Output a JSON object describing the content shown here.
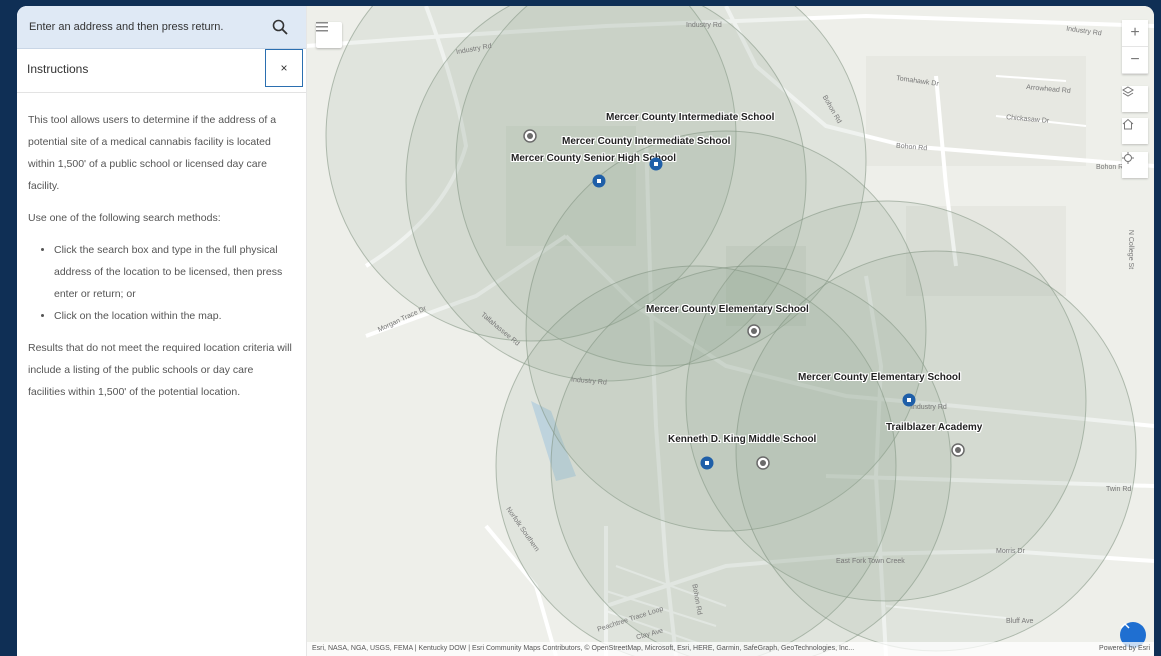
{
  "search": {
    "placeholder": "Enter an address and then press return."
  },
  "instructions": {
    "title": "Instructions",
    "close_label": "×",
    "para1": "This tool allows users to determine if the address of a potential site of a medical cannabis facility is located within 1,500' of a public school or licensed day care facility.",
    "para2": "Use one of the following search methods:",
    "bullets": [
      "Click the search box and type in the full physical address of the location to be licensed, then press enter or return; or",
      "Click on the location within the map."
    ],
    "para3": "Results that do not meet the required location criteria will include a listing of the public schools or day care facilities within 1,500' of the potential location."
  },
  "map": {
    "schools": {
      "s1": "Mercer County Intermediate School",
      "s2": "Mercer County Intermediate School",
      "s3": "Mercer County Senior High School",
      "s4": "Mercer County Elementary School",
      "s5": "Mercer County Elementary School",
      "s6": "Kenneth D. King Middle School",
      "s7": "Trailblazer Academy"
    },
    "roads": {
      "r1": "Industry Rd",
      "r2": "Industry Rd",
      "r3": "Industry Rd",
      "r4": "Tomahawk Dr",
      "r5": "Arrowhead Rd",
      "r6": "Chickasaw Dr",
      "r7": "Bohon Rd",
      "r8": "Bohon Rd",
      "r9": "Bohon Rd",
      "r10": "Morgan Trace Dr",
      "r11": "Tallahassee Rd",
      "r12": "Industry Rd",
      "r13": "Norfolk Southern",
      "r14": "N College St",
      "r15": "Twin Rd",
      "r16": "Morris Dr",
      "r17": "East Fork Town Creek",
      "r18": "Peachtree Trace Loop",
      "r19": "Clay Ave",
      "r20": "Bluff Ave",
      "r21": "Industry Rd",
      "r22": "Bohon Rd"
    },
    "attribution": "Esri, NASA, NGA, USGS, FEMA | Kentucky DOW | Esri Community Maps Contributors, © OpenStreetMap, Microsoft, Esri, HERE, Garmin, SafeGraph, GeoTechnologies, Inc...",
    "powered_by": "Powered by Esri",
    "colors": {
      "buffer_fill": "#8fa58f",
      "school_marker": "#1f5fa8",
      "daycare_marker": "#6b6b6b",
      "frame_bg": "#0f2f55",
      "search_bg": "#dfe9f5"
    }
  }
}
